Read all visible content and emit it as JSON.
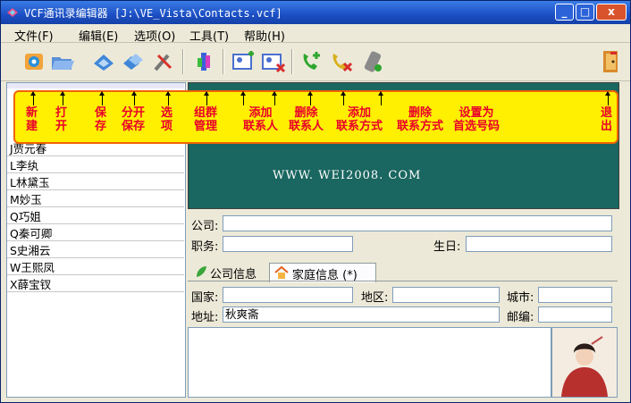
{
  "window": {
    "title": "VCF通讯录编辑器 [J:\\VE_Vista\\Contacts.vcf]"
  },
  "titlebar": {
    "min": "_",
    "max": "□",
    "close": "x"
  },
  "menu": [
    "文件(F)",
    "编辑(E)",
    "选项(O)",
    "工具(T)",
    "帮助(H)"
  ],
  "toolbar_icons": [
    "new-icon",
    "open-icon",
    "save-icon",
    "save-split-icon",
    "options-icon",
    "group-manage-icon",
    "add-contact-icon",
    "delete-contact-icon",
    "add-contact-method-icon",
    "delete-contact-method-icon",
    "set-preferred-number-icon",
    "exit-icon"
  ],
  "annotations": [
    {
      "l1": "新",
      "l2": "建"
    },
    {
      "l1": "打",
      "l2": "开"
    },
    {
      "l1": "保",
      "l2": "存"
    },
    {
      "l1": "分开",
      "l2": "保存"
    },
    {
      "l1": "选",
      "l2": "项"
    },
    {
      "l1": "组群",
      "l2": "管理"
    },
    {
      "l1": "添加",
      "l2": "联系人"
    },
    {
      "l1": "删除",
      "l2": "联系人"
    },
    {
      "l1": "添加",
      "l2": "联系方式"
    },
    {
      "l1": "删除",
      "l2": "联系方式"
    },
    {
      "l1": "设置为",
      "l2": "首选号码"
    },
    {
      "l1": "退",
      "l2": "出"
    }
  ],
  "contacts": [
    "J贾元春",
    "L李纨",
    "L林黛玉",
    "M妙玉",
    "Q巧姐",
    "Q秦可卿",
    "S史湘云",
    "W王熙凤",
    "X薛宝钗"
  ],
  "banner": {
    "text": "WWW. WEI2008. COM"
  },
  "form": {
    "company_label": "公司:",
    "company_value": "",
    "position_label": "职务:",
    "position_value": "",
    "birthday_label": "生日:",
    "birthday_value": ""
  },
  "tabs": [
    {
      "label": "公司信息",
      "active": false
    },
    {
      "label": "家庭信息 (*)",
      "active": true
    }
  ],
  "home": {
    "country_label": "国家:",
    "country_value": "",
    "region_label": "地区:",
    "region_value": "",
    "city_label": "城市:",
    "city_value": "",
    "address_label": "地址:",
    "address_value": "秋爽斋",
    "zip_label": "邮编:",
    "zip_value": ""
  }
}
